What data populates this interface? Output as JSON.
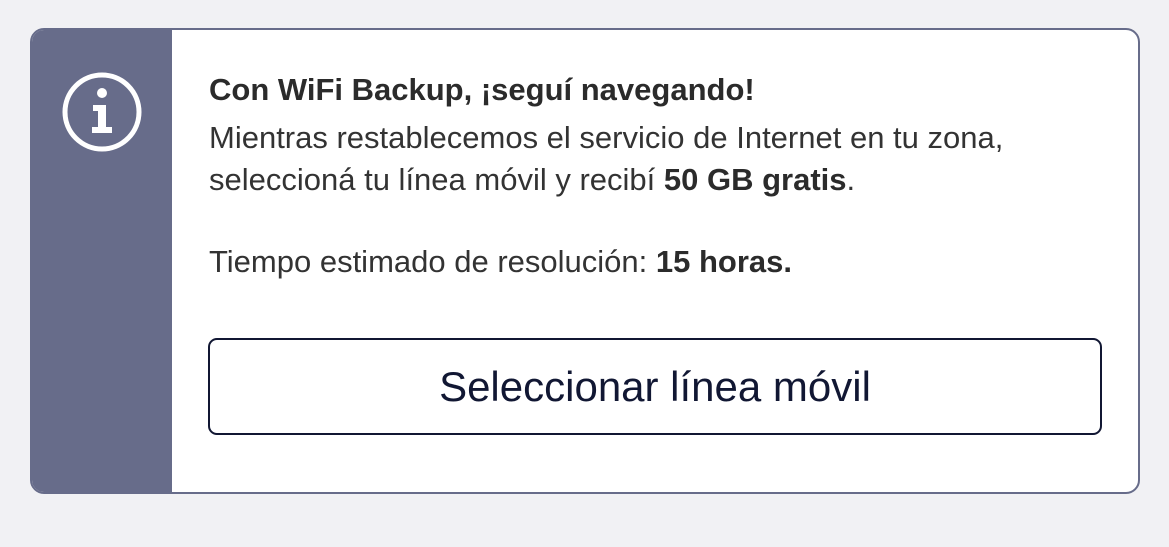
{
  "colors": {
    "accent": "#676c8a",
    "page_background": "#f1f1f4",
    "card_background": "#ffffff",
    "button_text": "#111733",
    "body_text": "#333333"
  },
  "notice": {
    "icon": "info-icon",
    "title": "Con WiFi Backup, ¡seguí navegando!",
    "message_prefix": "Mientras restablecemos el servicio de Internet en tu zona, seleccioná tu línea móvil y recibí ",
    "message_highlight": "50 GB gratis",
    "message_suffix": ".",
    "estimate_label": "Tiempo estimado de resolución: ",
    "estimate_value": "15 horas.",
    "button_label": "Seleccionar línea móvil"
  }
}
